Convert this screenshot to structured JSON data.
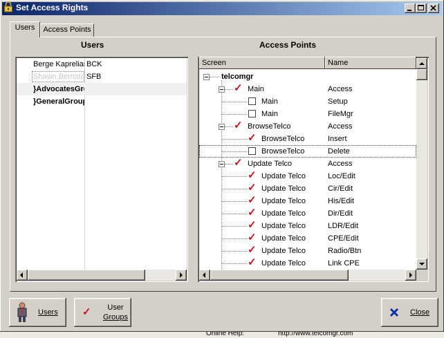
{
  "window": {
    "title": "Set Access Rights",
    "colors": {
      "titlebar_start": "#0a246a",
      "titlebar_end": "#a6caf0",
      "check_red": "#cc1020"
    }
  },
  "tabs": [
    {
      "label": "Users",
      "active": true
    },
    {
      "label": "Access Points",
      "active": false
    }
  ],
  "users_panel": {
    "title": "Users",
    "rows": [
      {
        "name": "Berge Kaprelian",
        "code": "BCK",
        "bold": false,
        "selected": false
      },
      {
        "name": "Shawn Bernstein",
        "code": "SFB",
        "bold": false,
        "selected": true
      },
      {
        "name": "}AdvocatesGroup",
        "code": "",
        "bold": true,
        "selected": false
      },
      {
        "name": "}GeneralGroup",
        "code": "",
        "bold": true,
        "selected": false
      }
    ]
  },
  "access_panel": {
    "title": "Access Points",
    "columns": [
      "Screen",
      "Name"
    ],
    "root": "telcomgr",
    "rows": [
      {
        "screen": "Main",
        "name": "Access",
        "level": 1,
        "checked": true,
        "expander": true
      },
      {
        "screen": "Main",
        "name": "Setup",
        "level": 2,
        "checked": false,
        "expander": false
      },
      {
        "screen": "Main",
        "name": "FileMgr",
        "level": 2,
        "checked": false,
        "expander": false
      },
      {
        "screen": "BrowseTelco",
        "name": "Access",
        "level": 1,
        "checked": true,
        "expander": true
      },
      {
        "screen": "BrowseTelco",
        "name": "Insert",
        "level": 2,
        "checked": true,
        "expander": false
      },
      {
        "screen": "BrowseTelco",
        "name": "Delete",
        "level": 2,
        "checked": false,
        "expander": false,
        "focused": true
      },
      {
        "screen": "Update Telco",
        "name": "Access",
        "level": 1,
        "checked": true,
        "expander": true
      },
      {
        "screen": "Update Telco",
        "name": "Loc/Edit",
        "level": 2,
        "checked": true,
        "expander": false
      },
      {
        "screen": "Update Telco",
        "name": "Cir/Edit",
        "level": 2,
        "checked": true,
        "expander": false
      },
      {
        "screen": "Update Telco",
        "name": "His/Edit",
        "level": 2,
        "checked": true,
        "expander": false
      },
      {
        "screen": "Update Telco",
        "name": "Dir/Edit",
        "level": 2,
        "checked": true,
        "expander": false
      },
      {
        "screen": "Update Telco",
        "name": "LDR/Edit",
        "level": 2,
        "checked": true,
        "expander": false
      },
      {
        "screen": "Update Telco",
        "name": "CPE/Edit",
        "level": 2,
        "checked": true,
        "expander": false
      },
      {
        "screen": "Update Telco",
        "name": "Radio/Btn",
        "level": 2,
        "checked": true,
        "expander": false
      },
      {
        "screen": "Update Telco",
        "name": "Link CPE",
        "level": 2,
        "checked": true,
        "expander": false
      }
    ]
  },
  "buttons": {
    "users": "Users",
    "user_groups_line1": "User",
    "user_groups_line2": "Groups",
    "close": "Close"
  },
  "behind_window": {
    "text_left": "Online Help:",
    "text_right": "http://www.telcomgr.com"
  }
}
